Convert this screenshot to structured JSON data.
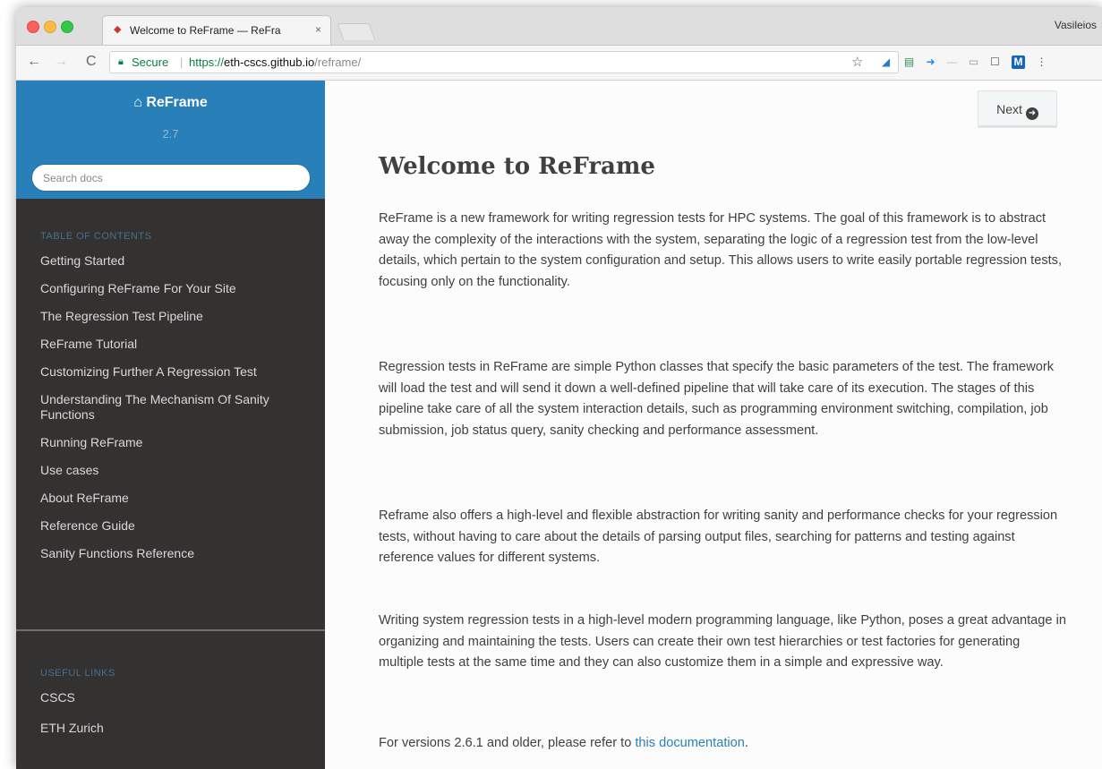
{
  "browser": {
    "tab_title": "Welcome to ReFrame — ReFra",
    "tab_close": "×",
    "profile_name": "Vasileios",
    "secure_label": "Secure",
    "url_scheme": "https://",
    "url_host": "eth-cscs.github.io",
    "url_path": "/reframe/",
    "nav": {
      "back": "←",
      "forward": "→",
      "reload": "C"
    },
    "star": "☆"
  },
  "sidebar": {
    "project_name": "ReFrame",
    "home_icon": "⌂",
    "version": "2.7",
    "search_placeholder": "Search docs",
    "toc_caption": "TABLE OF CONTENTS",
    "toc": [
      "Getting Started",
      "Configuring ReFrame For Your Site",
      "The Regression Test Pipeline",
      "ReFrame Tutorial",
      "Customizing Further A Regression Test",
      "Understanding The Mechanism Of Sanity Functions",
      "Running ReFrame",
      "Use cases",
      "About ReFrame",
      "Reference Guide",
      "Sanity Functions Reference"
    ],
    "links_caption": "USEFUL LINKS",
    "links": [
      "CSCS",
      "ETH Zurich"
    ]
  },
  "content": {
    "next_label": "Next",
    "title": "Welcome to ReFrame",
    "paragraphs": [
      "ReFrame is a new framework for writing regression tests for HPC systems. The goal of this framework is to abstract away the complexity of the interactions with the system, separating the logic of a regression test from the low-level details, which pertain to the system configuration and setup. This allows users to write easily portable regression tests, focusing only on the functionality.",
      "Regression tests in ReFrame are simple Python classes that specify the basic parameters of the test. The framework will load the test and will send it down a well-defined pipeline that will take care of its execution. The stages of this pipeline take care of all the system interaction details, such as programming environment switching, compilation, job submission, job status query, sanity checking and performance assessment.",
      "Reframe also offers a high-level and flexible abstraction for writing sanity and performance checks for your regression tests, without having to care about the details of parsing output files, searching for patterns and testing against reference values for different systems.",
      "Writing system regression tests in a high-level modern programming language, like Python, poses a great advantage in organizing and maintaining the tests. Users can create their own test hierarchies or test factories for generating multiple tests at the same time and they can also customize them in a simple and expressive way."
    ],
    "footer_prefix": "For versions 2.6.1 and older, please refer to ",
    "footer_link": "this documentation",
    "footer_suffix": "."
  },
  "colors": {
    "sidebar_header": "#2980b9",
    "sidebar_bg": "#343131",
    "link": "#2980b9",
    "secure_green": "#0b8043"
  }
}
